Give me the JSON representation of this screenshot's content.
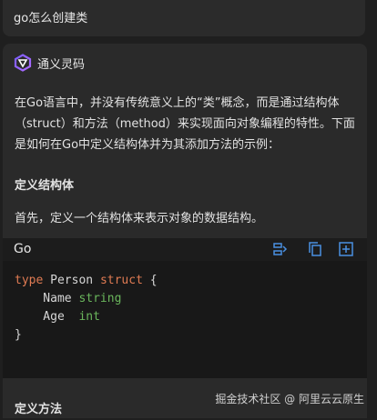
{
  "user": {
    "message": "go怎么创建类"
  },
  "bot": {
    "name": "通义灵码",
    "intro": "在Go语言中，并没有传统意义上的“类”概念，而是通过结构体（struct）和方法（method）来实现面向对象编程的特性。下面是如何在Go中定义结构体并为其添加方法的示例：",
    "heading_struct": "定义结构体",
    "struct_text": "首先，定义一个结构体来表示对象的数据结构。",
    "heading_method": "定义方法"
  },
  "code": {
    "language": "Go",
    "lines": {
      "l1_kw1": "type",
      "l1_id": " Person ",
      "l1_kw2": "struct",
      "l1_end": " {",
      "l2_id": "    Name ",
      "l2_ty": "string",
      "l3_id": "    Age  ",
      "l3_ty": "int",
      "l4": "}"
    },
    "icons": [
      "insert-code-icon",
      "copy-icon",
      "new-file-icon"
    ]
  },
  "watermark": "掘金技术社区 @ 阿里云云原生",
  "colors": {
    "keyword": "#e07b53",
    "type": "#6ab65c",
    "accent": "#4a90e2",
    "bg": "#1f1f1f"
  }
}
